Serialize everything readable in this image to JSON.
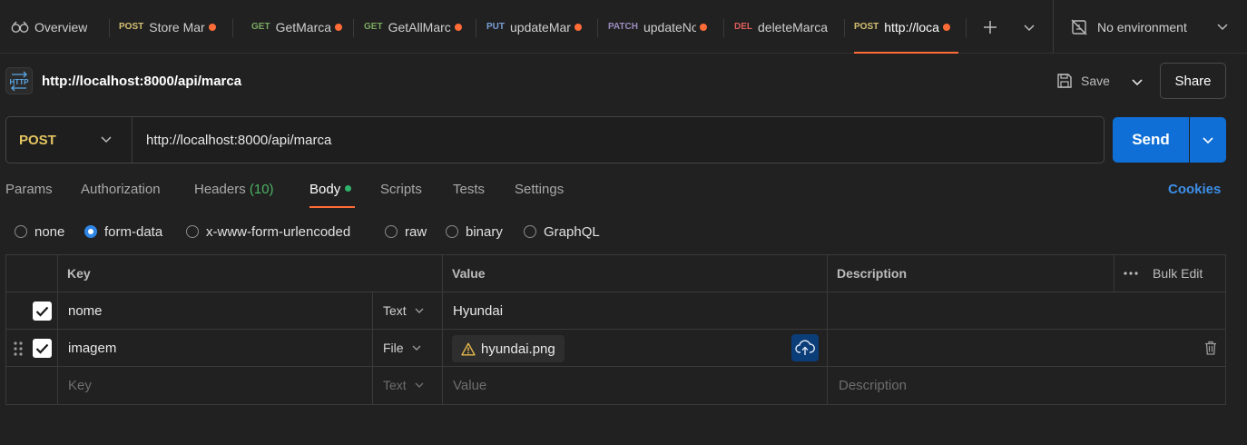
{
  "tabs": [
    {
      "label": "Overview"
    },
    {
      "method": "POST",
      "label": "Store Mar"
    },
    {
      "method": "GET",
      "label": "GetMarca"
    },
    {
      "method": "GET",
      "label": "GetAllMarc"
    },
    {
      "method": "PUT",
      "label": "updateMar"
    },
    {
      "method": "PATCH",
      "label": "updateNo"
    },
    {
      "method": "DEL",
      "label": "deleteMarca"
    },
    {
      "method": "POST",
      "label": "http://loca"
    }
  ],
  "environment": {
    "label": "No environment"
  },
  "request": {
    "title": "http://localhost:8000/api/marca",
    "method": "POST",
    "url": "http://localhost:8000/api/marca",
    "save_label": "Save",
    "share_label": "Share",
    "send_label": "Send"
  },
  "req_tabs": {
    "params": "Params",
    "authorization": "Authorization",
    "headers": "Headers",
    "headers_count": "(10)",
    "body": "Body",
    "scripts": "Scripts",
    "tests": "Tests",
    "settings": "Settings",
    "cookies": "Cookies"
  },
  "body_types": {
    "none": "none",
    "form_data": "form-data",
    "urlencoded": "x-www-form-urlencoded",
    "raw": "raw",
    "binary": "binary",
    "graphql": "GraphQL",
    "selected": "form-data"
  },
  "table": {
    "headers": {
      "key": "Key",
      "value": "Value",
      "description": "Description",
      "bulk_edit": "Bulk Edit"
    },
    "rows": [
      {
        "key": "nome",
        "type": "Text",
        "value": "Hyundai",
        "checked": true
      },
      {
        "key": "imagem",
        "type": "File",
        "value": "hyundai.png",
        "checked": true
      }
    ],
    "placeholder": {
      "key": "Key",
      "type": "Text",
      "value": "Value",
      "description": "Description"
    }
  }
}
